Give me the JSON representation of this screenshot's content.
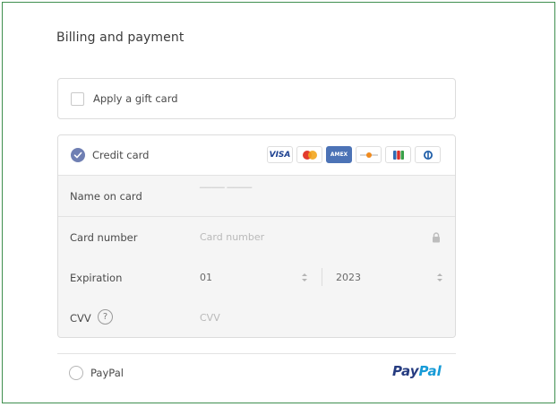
{
  "section": {
    "title": "Billing and payment"
  },
  "gift_card": {
    "label": "Apply a gift card",
    "checked": false
  },
  "credit_card": {
    "label": "Credit card",
    "selected": true,
    "accent_color": "#6f7fb3",
    "brands": [
      {
        "name": "visa-logo",
        "text": "VISA"
      },
      {
        "name": "mastercard-logo",
        "text": ""
      },
      {
        "name": "amex-logo",
        "text": "AMEX"
      },
      {
        "name": "discover-logo",
        "text": ""
      },
      {
        "name": "jcb-logo",
        "text": ""
      },
      {
        "name": "diners-logo",
        "text": ""
      }
    ],
    "fields": {
      "name": {
        "label": "Name on card",
        "placeholder": ""
      },
      "number": {
        "label": "Card number",
        "placeholder": "Card number"
      },
      "expiration": {
        "label": "Expiration",
        "month": "01",
        "year": "2023"
      },
      "cvv": {
        "label": "CVV",
        "help": "?",
        "placeholder": "CVV"
      }
    }
  },
  "paypal": {
    "label": "PayPal",
    "logo_pay": "Pay",
    "logo_pal": "Pal",
    "selected": false
  }
}
